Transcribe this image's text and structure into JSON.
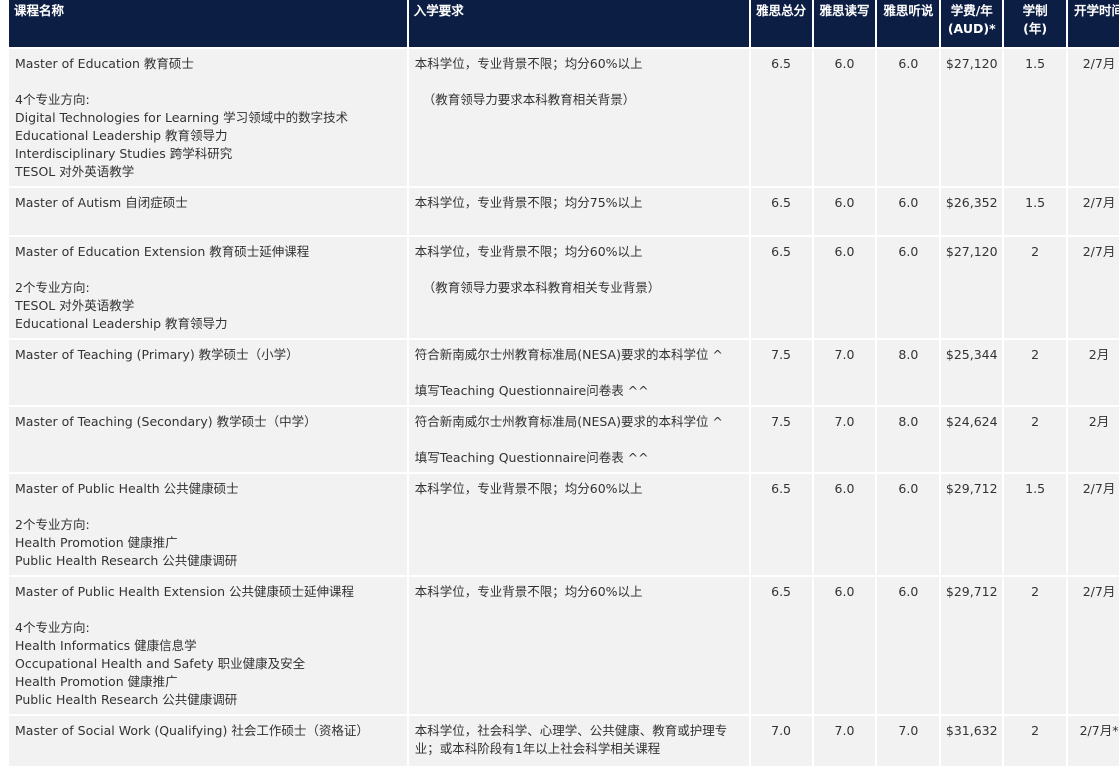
{
  "headers": {
    "name": "课程名称",
    "req": "入学要求",
    "ielts_total": "雅思总分",
    "ielts_rw": "雅思读写",
    "ielts_ls": "雅思听说",
    "fee_line1": "学费/年",
    "fee_line2": "(AUD)*",
    "dur_line1": "学制",
    "dur_line2": "(年)",
    "start": "开学时间"
  },
  "rows": [
    {
      "title": "Master of Education 教育硕士",
      "spec_label": "4个专业方向:",
      "specs": [
        "Digital Technologies for Learning 学习领域中的数字技术",
        "Educational Leadership 教育领导力",
        "Interdisciplinary Studies 跨学科研究",
        "TESOL 对外英语教学"
      ],
      "req1": "本科学位，专业背景不限；均分60%以上",
      "req2": "（教育领导力要求本科教育相关背景）",
      "ielts_total": "6.5",
      "ielts_rw": "6.0",
      "ielts_ls": "6.0",
      "fee": "$27,120",
      "duration": "1.5",
      "start": "2/7月"
    },
    {
      "title": "Master of Autism 自闭症硕士",
      "spec_label": "",
      "specs": [],
      "req1": "本科学位，专业背景不限；均分75%以上",
      "req2": "",
      "ielts_total": "6.5",
      "ielts_rw": "6.0",
      "ielts_ls": "6.0",
      "fee": "$26,352",
      "duration": "1.5",
      "start": "2/7月"
    },
    {
      "title": "Master of Education Extension 教育硕士延伸课程",
      "spec_label": "2个专业方向:",
      "specs": [
        "TESOL 对外英语教学",
        "Educational Leadership 教育领导力"
      ],
      "req1": "本科学位，专业背景不限；均分60%以上",
      "req2": "（教育领导力要求本科教育相关专业背景）",
      "ielts_total": "6.5",
      "ielts_rw": "6.0",
      "ielts_ls": "6.0",
      "fee": "$27,120",
      "duration": "2",
      "start": "2/7月"
    },
    {
      "title": "Master of Teaching (Primary) 教学硕士（小学）",
      "spec_label": "",
      "specs": [],
      "req1": "符合新南威尔士州教育标准局(NESA)要求的本科学位 ^",
      "req2": "填写Teaching Questionnaire问卷表 ^^",
      "ielts_total": "7.5",
      "ielts_rw": "7.0",
      "ielts_ls": "8.0",
      "fee": "$25,344",
      "duration": "2",
      "start": "2月"
    },
    {
      "title": "Master of Teaching (Secondary) 教学硕士（中学）",
      "spec_label": "",
      "specs": [],
      "req1": "符合新南威尔士州教育标准局(NESA)要求的本科学位 ^",
      "req2": "填写Teaching Questionnaire问卷表 ^^",
      "ielts_total": "7.5",
      "ielts_rw": "7.0",
      "ielts_ls": "8.0",
      "fee": "$24,624",
      "duration": "2",
      "start": "2月"
    },
    {
      "title": "Master of Public Health 公共健康硕士",
      "spec_label": "2个专业方向:",
      "specs": [
        "Health Promotion 健康推广",
        "Public Health Research 公共健康调研"
      ],
      "req1": "本科学位，专业背景不限；均分60%以上",
      "req2": "",
      "ielts_total": "6.5",
      "ielts_rw": "6.0",
      "ielts_ls": "6.0",
      "fee": "$29,712",
      "duration": "1.5",
      "start": "2/7月"
    },
    {
      "title": "Master of Public Health Extension 公共健康硕士延伸课程",
      "spec_label": "4个专业方向:",
      "specs": [
        "Health Informatics 健康信息学",
        "Occupational Health and Safety 职业健康及安全",
        "Health Promotion 健康推广",
        "Public Health Research 公共健康调研"
      ],
      "req1": "本科学位，专业背景不限；均分60%以上",
      "req2": "",
      "ielts_total": "6.5",
      "ielts_rw": "6.0",
      "ielts_ls": "6.0",
      "fee": "$29,712",
      "duration": "2",
      "start": "2/7月"
    },
    {
      "title": "Master of Social Work (Qualifying) 社会工作硕士（资格证）",
      "spec_label": "",
      "specs": [],
      "req1": "本科学位，社会科学、心理学、公共健康、教育或护理专业；或本科阶段有1年以上社会科学相关课程",
      "req2": "",
      "ielts_total": "7.0",
      "ielts_rw": "7.0",
      "ielts_ls": "7.0",
      "fee": "$31,632",
      "duration": "2",
      "start": "2/7月*"
    }
  ]
}
